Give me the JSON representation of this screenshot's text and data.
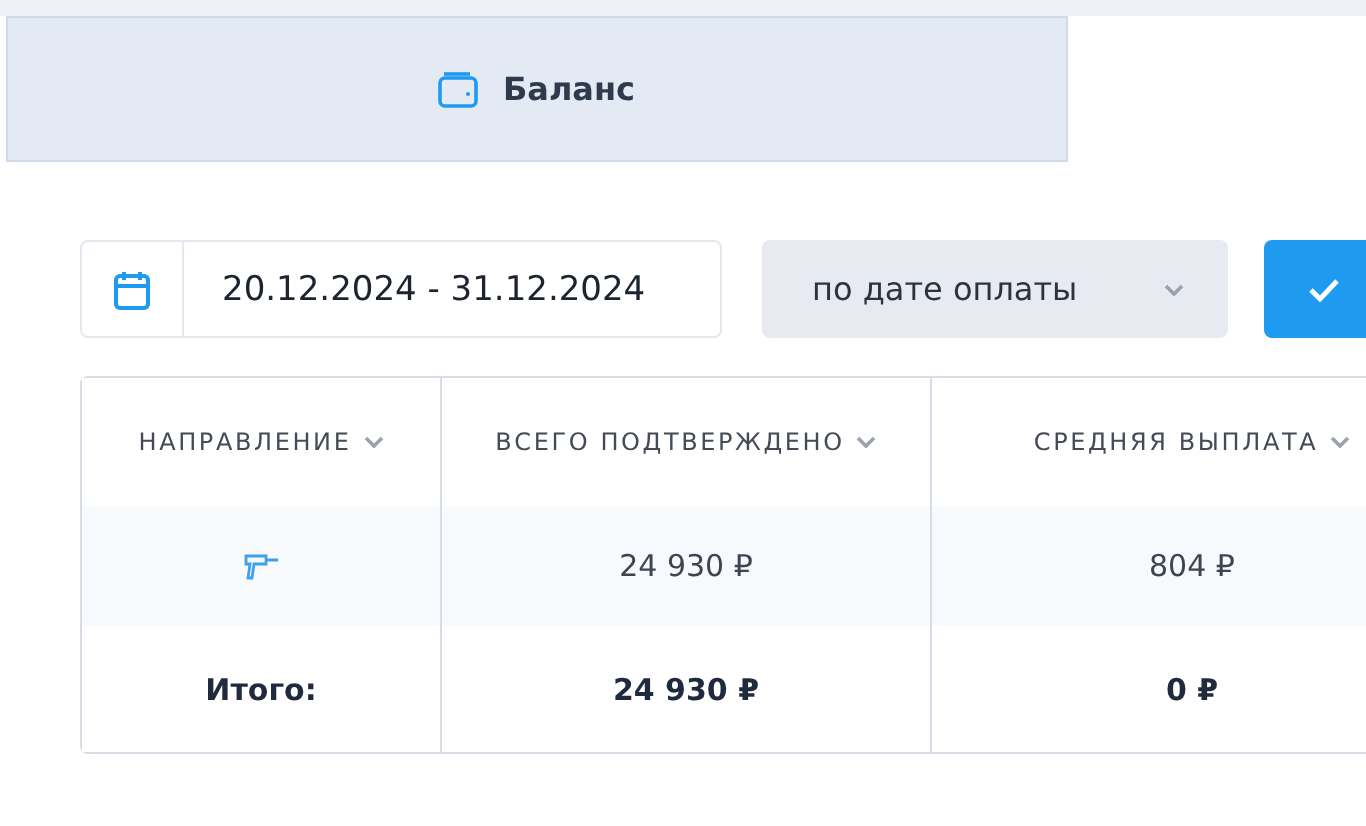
{
  "tabs": [
    {
      "label": "Баланс",
      "selected": true
    }
  ],
  "filters": {
    "date_range": "20.12.2024 - 31.12.2024",
    "date_mode": "по дате оплаты"
  },
  "table": {
    "columns": [
      "НАПРАВЛЕНИЕ",
      "ВСЕГО ПОДТВЕРЖДЕНО",
      "СРЕДНЯЯ ВЫПЛАТА"
    ],
    "rows": [
      {
        "kind": "data",
        "cells": [
          "",
          "24 930 ₽",
          "804 ₽"
        ]
      },
      {
        "kind": "total",
        "cells": [
          "Итого:",
          "24 930 ₽",
          "0 ₽"
        ]
      }
    ]
  }
}
